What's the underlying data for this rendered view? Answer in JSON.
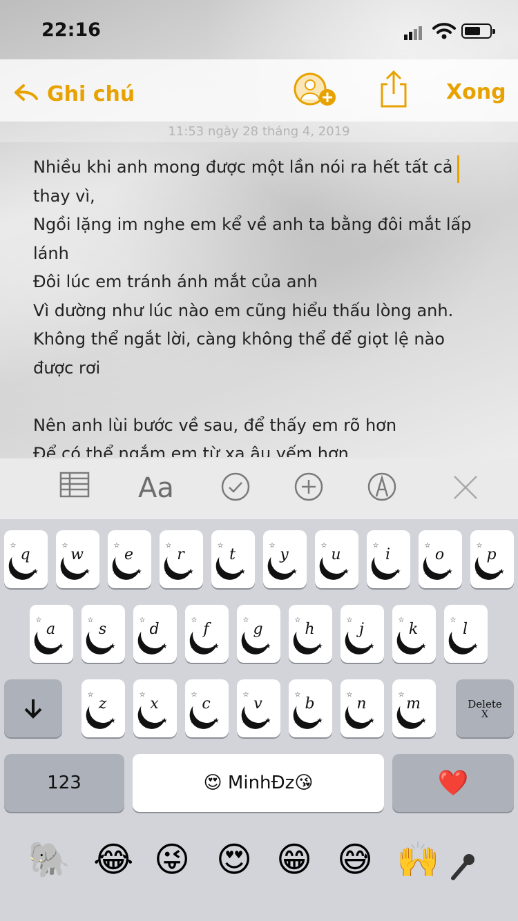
{
  "status_bar": {
    "time": "22:16"
  },
  "navbar": {
    "back_label": "Ghi chú",
    "done_label": "Xong"
  },
  "note": {
    "date": "11:53 ngày 28 tháng 4, 2019",
    "lines": [
      "Nhiều khi anh mong được một lần nói ra hết tất cả",
      "thay vì,",
      "Ngồi lặng im nghe em kể về anh ta bằng đôi mắt lấp",
      "lánh",
      "Đôi lúc em tránh ánh mắt của anh",
      "Vì dường như lúc nào em cũng hiểu thấu lòng anh.",
      "Không thể ngắt lời, càng không thể để giọt lệ nào",
      "được rơi",
      "",
      "Nên anh lùi bước về sau, để thấy em rõ hơn",
      "Để có thể ngắm em từ xa âu yếm hơn"
    ]
  },
  "toolbar": {
    "format_label": "Aa"
  },
  "keyboard": {
    "row1": [
      "q",
      "w",
      "e",
      "r",
      "t",
      "y",
      "u",
      "i",
      "o",
      "p"
    ],
    "row2": [
      "a",
      "s",
      "d",
      "f",
      "g",
      "h",
      "j",
      "k",
      "l"
    ],
    "row3": [
      "z",
      "x",
      "c",
      "v",
      "b",
      "n",
      "m"
    ],
    "delete_label": "Delete",
    "numbers_label": "123",
    "space_label": "😍 MinhĐz😘",
    "return_label": "❤️",
    "emoji_bar": [
      "🐘",
      "😂",
      "😜",
      "😍",
      "😁",
      "😅",
      "🙌"
    ]
  }
}
